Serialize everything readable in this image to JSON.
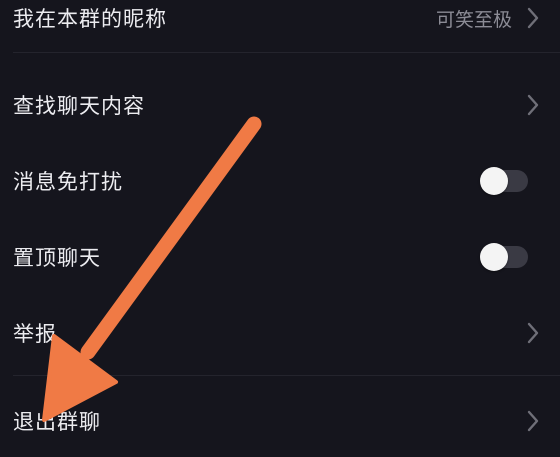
{
  "settings": {
    "nickname": {
      "label": "我在本群的昵称",
      "value": "可笑至极"
    },
    "search_chat": {
      "label": "查找聊天内容"
    },
    "mute": {
      "label": "消息免打扰",
      "enabled": false
    },
    "pin": {
      "label": "置顶聊天",
      "enabled": false
    },
    "report": {
      "label": "举报"
    },
    "leave": {
      "label": "退出群聊"
    }
  },
  "colors": {
    "background": "#15151d",
    "arrow": "#f07a45",
    "toggle_track": "#3a3a44",
    "toggle_knob": "#f4f4f4"
  },
  "icons": {
    "chevron": "chevron-right-icon"
  }
}
